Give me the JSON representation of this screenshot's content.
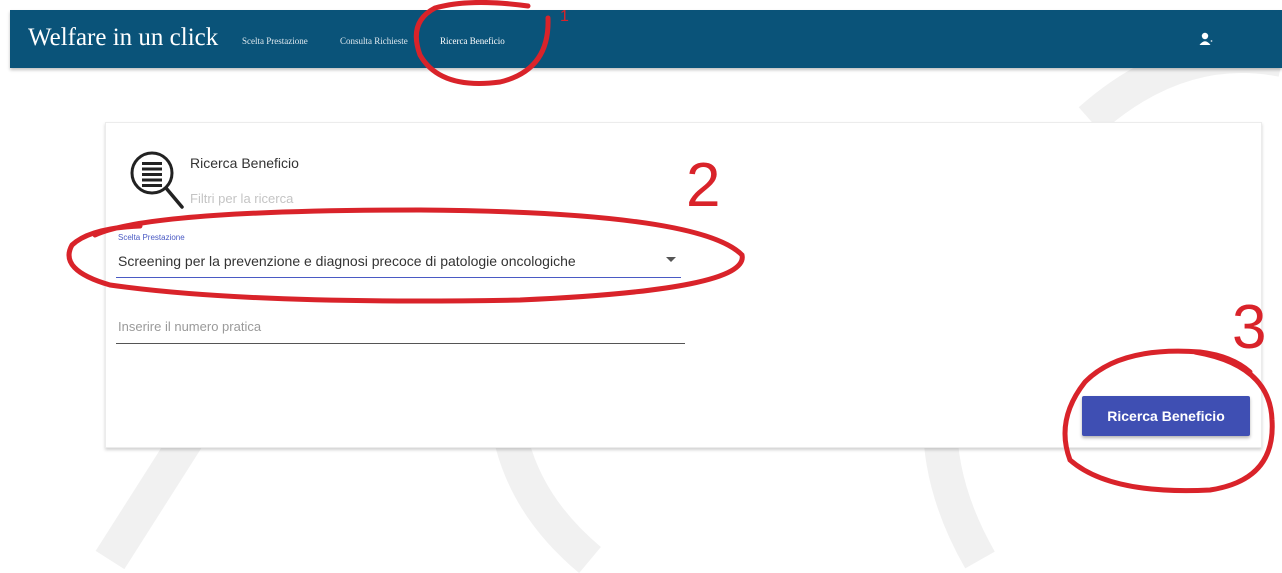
{
  "navbar": {
    "brand": "Welfare in un click",
    "links": [
      {
        "label": "Scelta Prestazione"
      },
      {
        "label": "Consulta Richieste"
      },
      {
        "label": "Ricerca Beneficio",
        "active": true
      }
    ],
    "user_icon": "user-icon"
  },
  "card": {
    "icon": "search-document-icon",
    "title": "Ricerca Beneficio",
    "subtitle": "Filtri per la ricerca",
    "select": {
      "label": "Scelta Prestazione",
      "value": "Screening per la prevenzione e diagnosi precoce di patologie oncologiche"
    },
    "input": {
      "placeholder": "Inserire il numero pratica",
      "value": ""
    },
    "button_label": "Ricerca Beneficio"
  },
  "annotations": {
    "step1": "1",
    "step2": "2",
    "step3": "3",
    "color": "#d9232a"
  },
  "colors": {
    "navbar": "#0a5379",
    "accent": "#3f4fb3",
    "annotation": "#d9232a"
  }
}
